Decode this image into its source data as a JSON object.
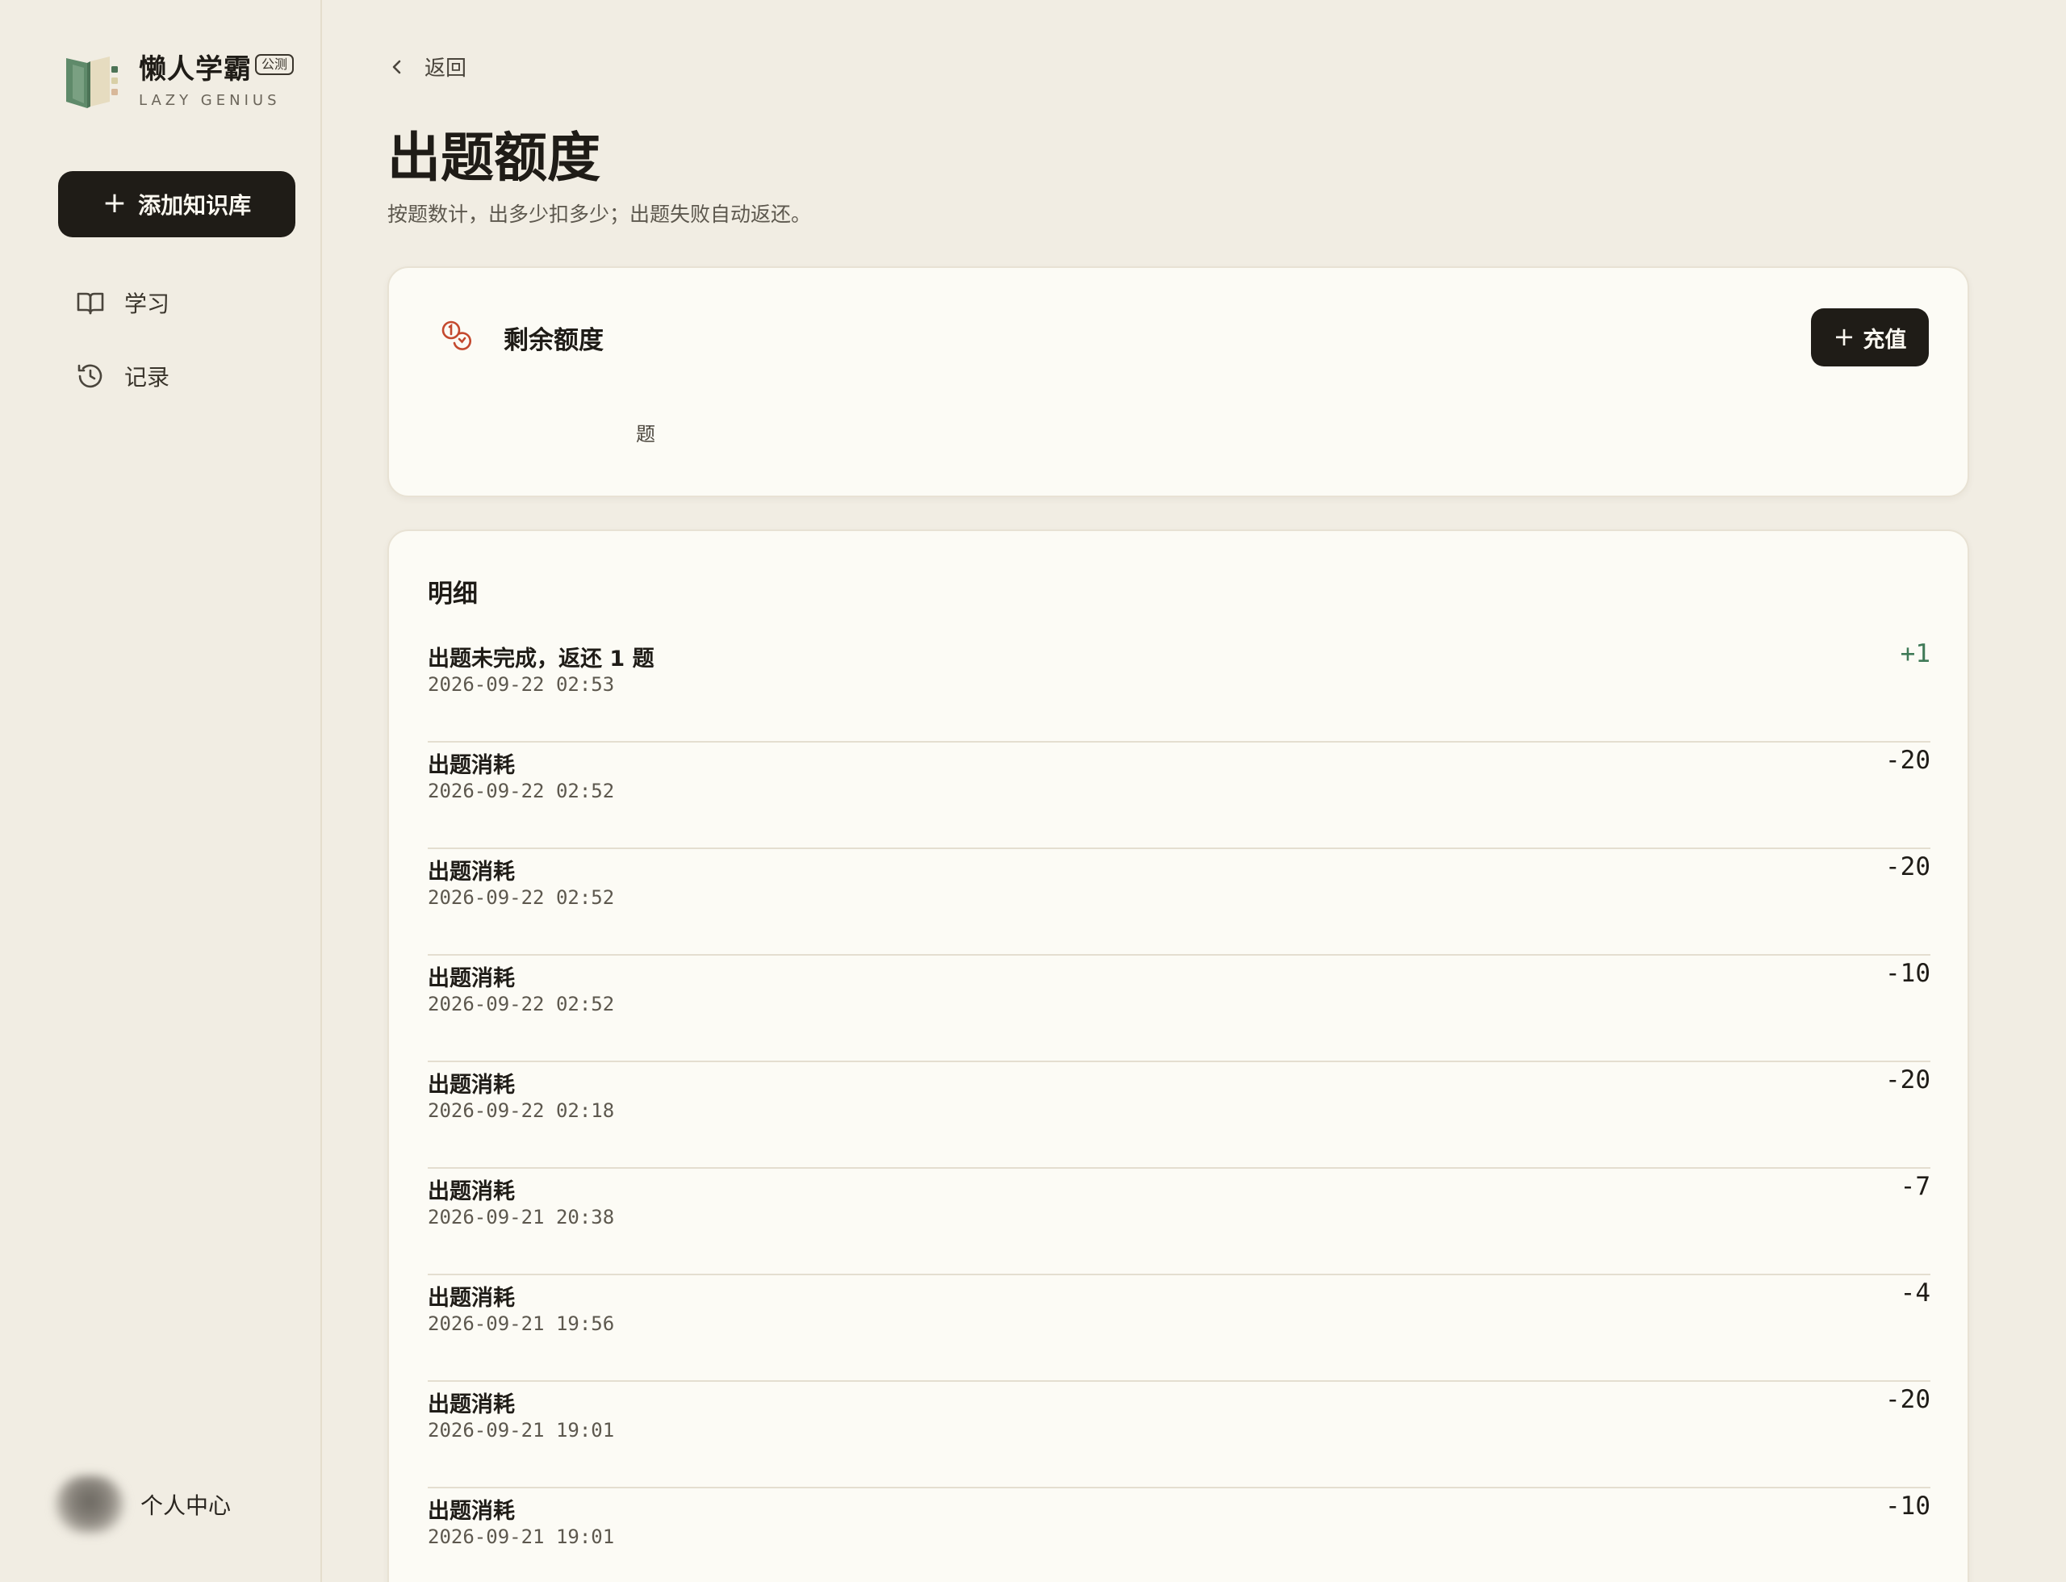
{
  "brand": {
    "name": "懒人学霸",
    "badge": "公测",
    "subtitle": "LAZY GENIUS"
  },
  "sidebar": {
    "add_button": {
      "icon": "plus-icon",
      "label": "添加知识库"
    },
    "items": [
      {
        "icon": "book-icon",
        "label": "学习"
      },
      {
        "icon": "history-icon",
        "label": "记录"
      }
    ],
    "profile": {
      "label": "个人中心"
    }
  },
  "header": {
    "back_label": "返回",
    "title": "出题额度",
    "subtitle": "按题数计，出多少扣多少；出题失败自动返还。"
  },
  "quota": {
    "icon": "coins-icon",
    "title": "剩余额度",
    "value": "",
    "unit": "题",
    "recharge_label": "充值"
  },
  "detail": {
    "title": "明细",
    "rows": [
      {
        "title": "出题未完成，返还 1 题",
        "time": "2026-09-22 02:53",
        "amount": "+1",
        "balance": ""
      },
      {
        "title": "出题消耗",
        "time": "2026-09-22 02:52",
        "amount": "-20",
        "balance": ""
      },
      {
        "title": "出题消耗",
        "time": "2026-09-22 02:52",
        "amount": "-20",
        "balance": ""
      },
      {
        "title": "出题消耗",
        "time": "2026-09-22 02:52",
        "amount": "-10",
        "balance": ""
      },
      {
        "title": "出题消耗",
        "time": "2026-09-22 02:18",
        "amount": "-20",
        "balance": ""
      },
      {
        "title": "出题消耗",
        "time": "2026-09-21 20:38",
        "amount": "-7",
        "balance": ""
      },
      {
        "title": "出题消耗",
        "time": "2026-09-21 19:56",
        "amount": "-4",
        "balance": ""
      },
      {
        "title": "出题消耗",
        "time": "2026-09-21 19:01",
        "amount": "-20",
        "balance": ""
      },
      {
        "title": "出题消耗",
        "time": "2026-09-21 19:01",
        "amount": "-10",
        "balance": ""
      }
    ]
  },
  "colors": {
    "background": "#f1ede3",
    "card": "#fcfbf5",
    "primary_button": "#1f1c17",
    "positive_amount": "#3f7a57",
    "accent_icon": "#c4492e"
  }
}
